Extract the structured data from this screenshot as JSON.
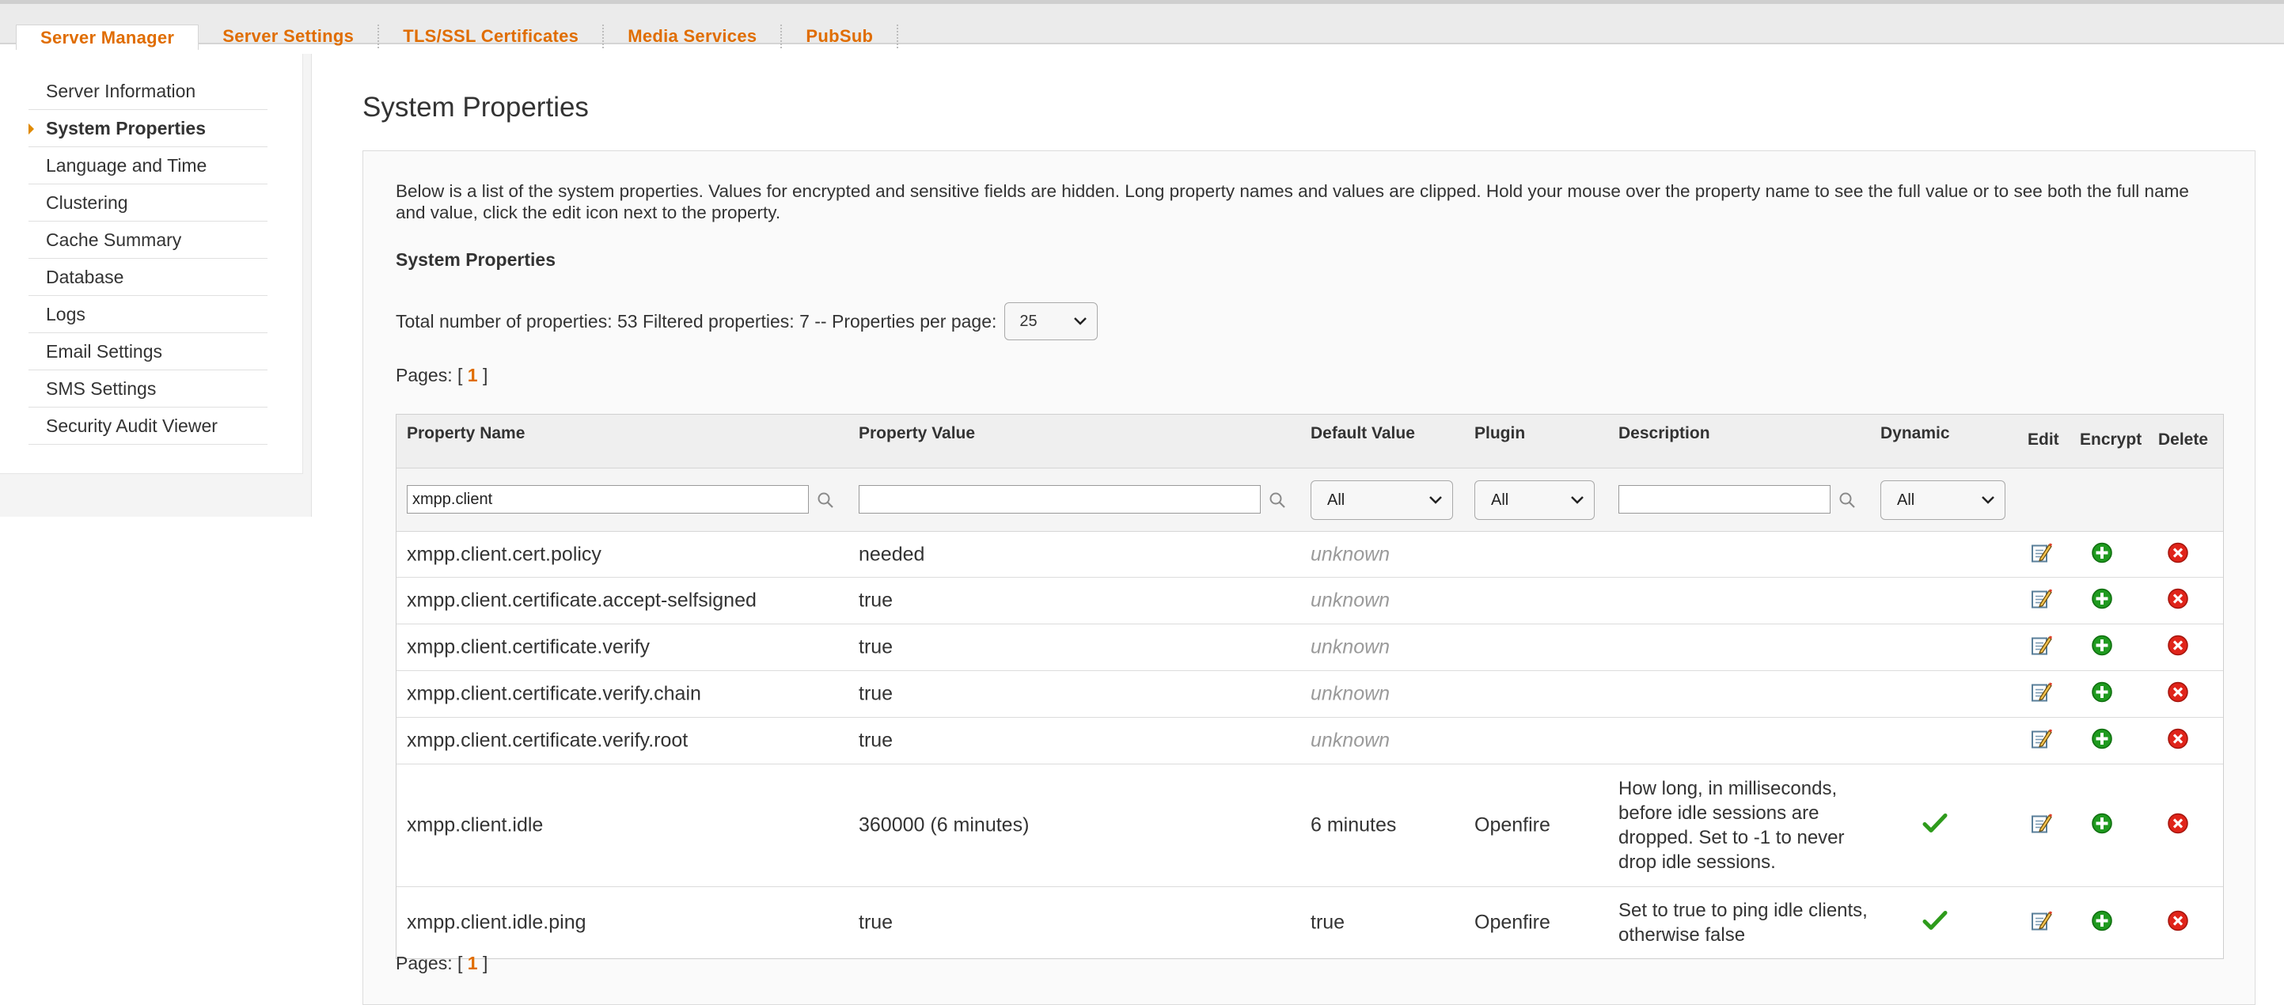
{
  "tabs": [
    "Server Manager",
    "Server Settings",
    "TLS/SSL Certificates",
    "Media Services",
    "PubSub"
  ],
  "sidebar": {
    "items": [
      "Server Information",
      "System Properties",
      "Language and Time",
      "Clustering",
      "Cache Summary",
      "Database",
      "Logs",
      "Email Settings",
      "SMS Settings",
      "Security Audit Viewer"
    ],
    "active": "System Properties"
  },
  "page_title": "System Properties",
  "intro": "Below is a list of the system properties. Values for encrypted and sensitive fields are hidden. Long property names and values are clipped. Hold your mouse over the property name to see the full value or to see both the full name and value, click the edit icon next to the property.",
  "section_title": "System Properties",
  "totals_text": "Total number of properties: 53 Filtered properties: 7 -- Properties per page:",
  "per_page": "25",
  "pages": {
    "label": "Pages: [",
    "current": "1",
    "close": "]"
  },
  "table": {
    "headers": {
      "name": "Property Name",
      "value": "Property Value",
      "default": "Default Value",
      "plugin": "Plugin",
      "description": "Description",
      "dynamic": "Dynamic",
      "edit": "Edit",
      "encrypt": "Encrypt",
      "delete": "Delete"
    },
    "filters": {
      "name": "xmpp.client",
      "value": "",
      "default": "All",
      "plugin": "All",
      "description": "",
      "dynamic": "All"
    },
    "rows": [
      {
        "name": "xmpp.client.cert.policy",
        "value": "needed",
        "default": "unknown",
        "plugin": "",
        "description": "",
        "dynamic": false
      },
      {
        "name": "xmpp.client.certificate.accept-selfsigned",
        "value": "true",
        "default": "unknown",
        "plugin": "",
        "description": "",
        "dynamic": false
      },
      {
        "name": "xmpp.client.certificate.verify",
        "value": "true",
        "default": "unknown",
        "plugin": "",
        "description": "",
        "dynamic": false
      },
      {
        "name": "xmpp.client.certificate.verify.chain",
        "value": "true",
        "default": "unknown",
        "plugin": "",
        "description": "",
        "dynamic": false
      },
      {
        "name": "xmpp.client.certificate.verify.root",
        "value": "true",
        "default": "unknown",
        "plugin": "",
        "description": "",
        "dynamic": false
      },
      {
        "name": "xmpp.client.idle",
        "value": "360000 (6 minutes)",
        "default": "6 minutes",
        "plugin": "Openfire",
        "description": "How long, in milliseconds, before idle sessions are dropped. Set to -1 to never drop idle sessions.",
        "dynamic": true
      },
      {
        "name": "xmpp.client.idle.ping",
        "value": "true",
        "default": "true",
        "plugin": "Openfire",
        "description": "Set to true to ping idle clients, otherwise false",
        "dynamic": true
      }
    ]
  },
  "colors": {
    "accent": "#e06d00",
    "check": "#2e9b1c",
    "encrypt": "#1f9a1f",
    "delete": "#e0241a"
  },
  "icons": {
    "search": "search-icon",
    "edit": "edit-icon",
    "encrypt": "encrypt-icon",
    "delete": "delete-icon",
    "dynamic": "checkmark-icon",
    "dropdown": "chevron-down-icon"
  }
}
